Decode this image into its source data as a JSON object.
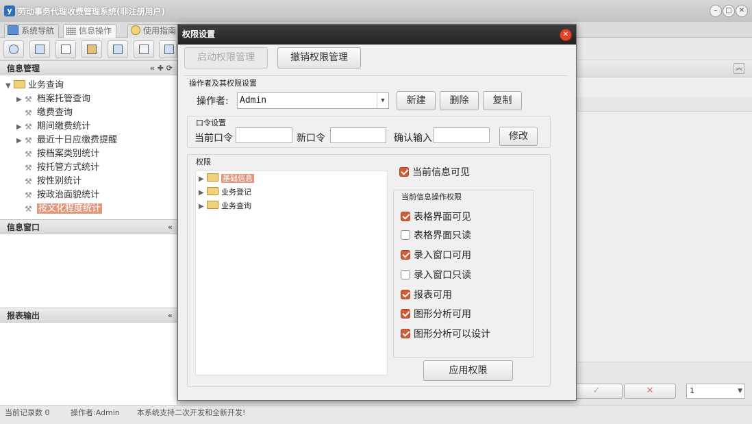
{
  "app": {
    "title": "劳动事务代理收费管理系统(非注册用户)",
    "icon_text": "y",
    "tabs": [
      {
        "label": "系统导航"
      },
      {
        "label": "信息操作"
      },
      {
        "label": "使用指南"
      }
    ]
  },
  "left": {
    "info_management": "信息管理",
    "tree": [
      {
        "label": "业务查询"
      },
      {
        "label": "档案托管查询"
      },
      {
        "label": "缴费查询"
      },
      {
        "label": "期间缴费统计"
      },
      {
        "label": "最近十日应缴费提醒"
      },
      {
        "label": "按档案类别统计"
      },
      {
        "label": "按托管方式统计"
      },
      {
        "label": "按性别统计"
      },
      {
        "label": "按政治面貌统计"
      },
      {
        "label": "按文化程度统计"
      }
    ],
    "info_window": "信息窗口",
    "report_output": "报表输出"
  },
  "right": {
    "check_symbol": "✓",
    "cross_symbol": "✕",
    "page_value": "1"
  },
  "status": {
    "record_count": "当前记录数 0",
    "operator": "操作者:Admin",
    "message": "本系统支持二次开发和全新开发!"
  },
  "modal": {
    "title": "权限设置",
    "enable_btn": "启动权限管理",
    "revoke_btn": "撤销权限管理",
    "operator_section": "操作者及其权限设置",
    "operator_label": "操作者:",
    "operator_value": "Admin",
    "new_btn": "新建",
    "delete_btn": "删除",
    "copy_btn": "复制",
    "password_section": "口令设置",
    "current_pwd": "当前口令",
    "new_pwd": "新口令",
    "confirm_pwd": "确认输入",
    "modify_btn": "修改",
    "permission_section": "权限",
    "perm_tree": [
      {
        "label": "基础信息"
      },
      {
        "label": "业务登记"
      },
      {
        "label": "业务查询"
      }
    ],
    "current_visible": {
      "label": "当前信息可见",
      "checked": true
    },
    "ops_section": "当前信息操作权限",
    "ops": [
      {
        "label": "表格界面可见",
        "checked": true
      },
      {
        "label": "表格界面只读",
        "checked": false
      },
      {
        "label": "录入窗口可用",
        "checked": true
      },
      {
        "label": "录入窗口只读",
        "checked": false
      },
      {
        "label": "报表可用",
        "checked": true
      },
      {
        "label": "图形分析可用",
        "checked": true
      },
      {
        "label": "图形分析可以设计",
        "checked": true
      }
    ],
    "apply_btn": "应用权限"
  },
  "colors": {
    "accent": "#d35c36",
    "selection": "#e2967c",
    "modal_title_bg": "#2e2e2e"
  }
}
